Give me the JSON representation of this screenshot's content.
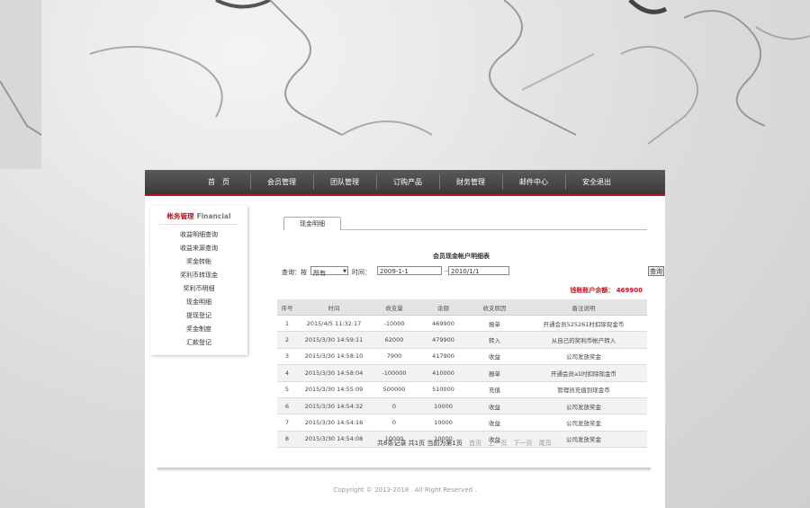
{
  "nav": {
    "items": [
      "首　页",
      "会员管理",
      "团队管理",
      "订购产品",
      "财务管理",
      "邮件中心",
      "安全退出"
    ]
  },
  "sidebar": {
    "title_cn": "帐务管理",
    "title_en": "Financial",
    "items": [
      "收益明细查询",
      "收益来源查询",
      "奖金转帐",
      "奖利币转现金",
      "奖利币明细",
      "现金明细",
      "提现登记",
      "奖金制度",
      "汇款登记"
    ]
  },
  "tab": {
    "label": "现金明细"
  },
  "report": {
    "title": "会员现金帐户明细表"
  },
  "query": {
    "label": "查询：按",
    "select_value": "所有",
    "time_label": "时间：",
    "start_date": "2009-1-1",
    "separator": "--",
    "end_date": "2010/1/1",
    "button_label": "查询"
  },
  "balance": {
    "text": "钱账账户余额： 469900"
  },
  "table": {
    "headers": [
      "序号",
      "时间",
      "收支量",
      "余额",
      "收支原因",
      "备注说明"
    ],
    "rows": [
      [
        "1",
        "2015/4/5 11:32:17",
        "-10000",
        "469900",
        "报单",
        "开通会员525261时扣除现金币"
      ],
      [
        "2",
        "2015/3/30 14:59:11",
        "62000",
        "479900",
        "转入",
        "从自己的奖利币帐户转入"
      ],
      [
        "3",
        "2015/3/30 14:58:10",
        "7900",
        "417900",
        "收益",
        "公司发放奖金"
      ],
      [
        "4",
        "2015/3/30 14:58:04",
        "-100000",
        "410000",
        "报单",
        "开通会员a1时扣除现金币"
      ],
      [
        "5",
        "2015/3/30 14:55:09",
        "500000",
        "510000",
        "充值",
        "管理员充值到现金币"
      ],
      [
        "6",
        "2015/3/30 14:54:32",
        "0",
        "10000",
        "收益",
        "公司发放奖金"
      ],
      [
        "7",
        "2015/3/30 14:54:16",
        "0",
        "10000",
        "收益",
        "公司发放奖金"
      ],
      [
        "8",
        "2015/3/30 14:54:08",
        "10000",
        "10000",
        "收益",
        "公司发放奖金"
      ]
    ]
  },
  "pager": {
    "summary": "共8条记录 共1页 当前为第1页",
    "first": "首页",
    "prev": "上一页",
    "next": "下一页",
    "last": "尾页"
  },
  "footer": {
    "copyright": "Copyright © 2013-2018 . All Right Reserved ."
  }
}
